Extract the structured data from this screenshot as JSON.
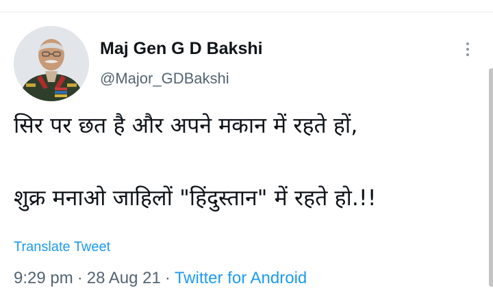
{
  "tweet": {
    "author": {
      "display_name": "Maj Gen G D Bakshi",
      "handle": "@Major_GDBakshi"
    },
    "text_lines": [
      "सिर पर छत है और अपने मकान में रहते हों,",
      "शुक्र मनाओ जाहिलों \"हिंदुस्तान\" में रहते हो.!!"
    ],
    "translate_label": "Translate Tweet",
    "time": "9:29 pm",
    "date": "28 Aug 21",
    "separator": "·",
    "source": "Twitter for Android"
  },
  "icons": {
    "more": "more-vertical-icon",
    "avatar": "profile-photo"
  },
  "colors": {
    "link_blue": "#1d9bf0",
    "secondary_text": "#536471",
    "primary_text": "#0f1419"
  }
}
